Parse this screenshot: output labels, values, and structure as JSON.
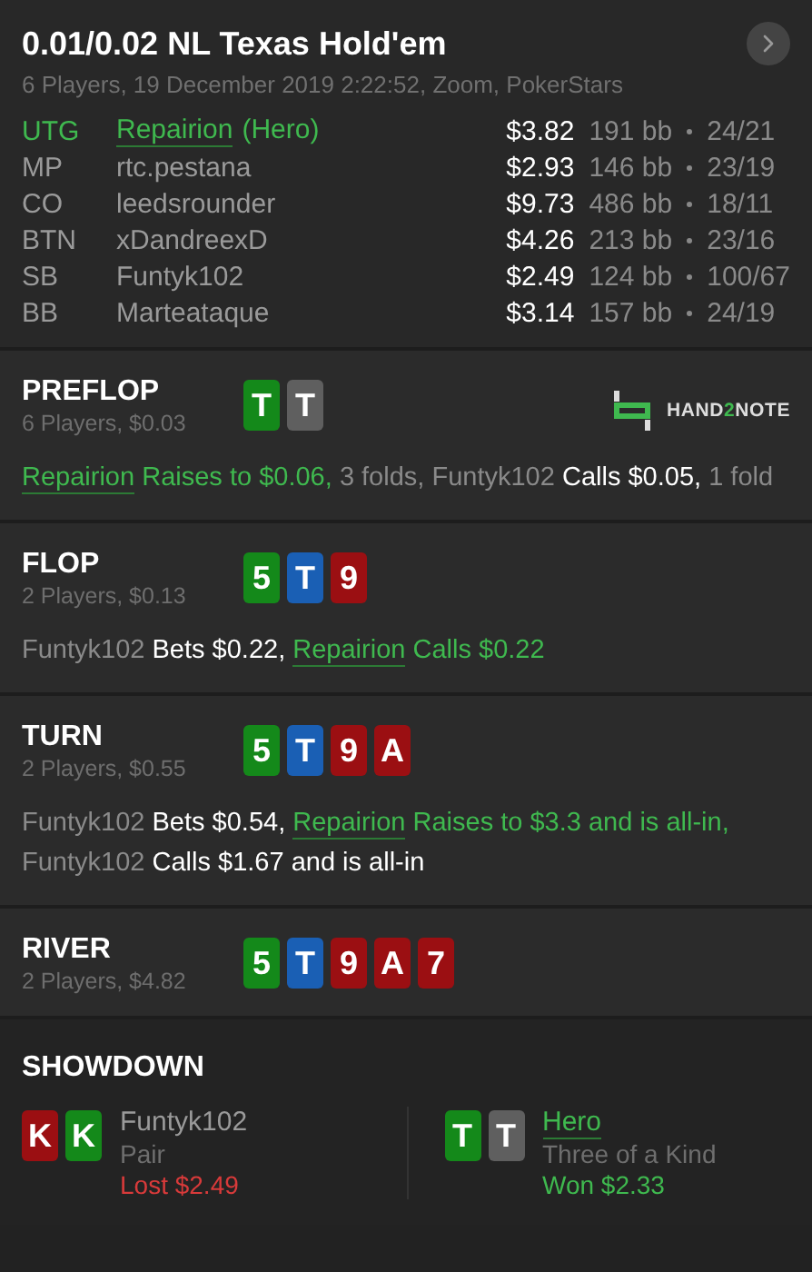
{
  "header": {
    "title": "0.01/0.02 NL Texas Hold'em",
    "subtitle": "6 Players, 19 December 2019 2:22:52, Zoom, PokerStars"
  },
  "players": [
    {
      "position": "UTG",
      "name": "Repairion",
      "hero": true,
      "hero_tag": "(Hero)",
      "stack": "$3.82",
      "bb": "191 bb",
      "stats": "24/21"
    },
    {
      "position": "MP",
      "name": "rtc.pestana",
      "hero": false,
      "stack": "$2.93",
      "bb": "146 bb",
      "stats": "23/19"
    },
    {
      "position": "CO",
      "name": "leedsrounder",
      "hero": false,
      "stack": "$9.73",
      "bb": "486 bb",
      "stats": "18/11"
    },
    {
      "position": "BTN",
      "name": "xDandreexD",
      "hero": false,
      "stack": "$4.26",
      "bb": "213 bb",
      "stats": "23/16"
    },
    {
      "position": "SB",
      "name": "Funtyk102",
      "hero": false,
      "stack": "$2.49",
      "bb": "124 bb",
      "stats": "100/67"
    },
    {
      "position": "BB",
      "name": "Marteataque",
      "hero": false,
      "stack": "$3.14",
      "bb": "157 bb",
      "stats": "24/19"
    }
  ],
  "logo": {
    "prefix": "HAND",
    "accent": "2",
    "suffix": "NOTE"
  },
  "streets": [
    {
      "name": "PREFLOP",
      "info": "6 Players, $0.03",
      "show_logo": true,
      "cards": [
        {
          "rank": "T",
          "color": "#14891a"
        },
        {
          "rank": "T",
          "color": "#5f5f5f"
        }
      ],
      "actions": [
        [
          {
            "kind": "hero",
            "text": "Repairion"
          },
          {
            "kind": "hero_action",
            "text": "Raises to $0.06,"
          },
          {
            "kind": "muted",
            "text": "3 folds, Funtyk102"
          },
          {
            "kind": "action",
            "text": "Calls $0.05,"
          },
          {
            "kind": "muted",
            "text": "1 fold"
          }
        ]
      ]
    },
    {
      "name": "FLOP",
      "info": "2 Players, $0.13",
      "show_logo": false,
      "cards": [
        {
          "rank": "5",
          "color": "#14891a"
        },
        {
          "rank": "T",
          "color": "#1a5fb4"
        },
        {
          "rank": "9",
          "color": "#9b0f12"
        }
      ],
      "actions": [
        [
          {
            "kind": "muted",
            "text": "Funtyk102"
          },
          {
            "kind": "action",
            "text": "Bets $0.22,"
          },
          {
            "kind": "hero",
            "text": "Repairion"
          },
          {
            "kind": "hero_action",
            "text": "Calls $0.22"
          }
        ]
      ]
    },
    {
      "name": "TURN",
      "info": "2 Players, $0.55",
      "show_logo": false,
      "cards": [
        {
          "rank": "5",
          "color": "#14891a"
        },
        {
          "rank": "T",
          "color": "#1a5fb4"
        },
        {
          "rank": "9",
          "color": "#9b0f12"
        },
        {
          "rank": "A",
          "color": "#9b0f12"
        }
      ],
      "actions": [
        [
          {
            "kind": "muted",
            "text": "Funtyk102"
          },
          {
            "kind": "action",
            "text": "Bets $0.54,"
          },
          {
            "kind": "hero",
            "text": "Repairion"
          },
          {
            "kind": "hero_action",
            "text": "Raises to $3.3 and is all-in,"
          }
        ],
        [
          {
            "kind": "muted",
            "text": "Funtyk102"
          },
          {
            "kind": "action",
            "text": "Calls $1.67 and is all-in"
          }
        ]
      ]
    },
    {
      "name": "RIVER",
      "info": "2 Players, $4.82",
      "show_logo": false,
      "cards": [
        {
          "rank": "5",
          "color": "#14891a"
        },
        {
          "rank": "T",
          "color": "#1a5fb4"
        },
        {
          "rank": "9",
          "color": "#9b0f12"
        },
        {
          "rank": "A",
          "color": "#9b0f12"
        },
        {
          "rank": "7",
          "color": "#9b0f12"
        }
      ]
    }
  ],
  "showdown": {
    "title": "SHOWDOWN",
    "hands": [
      {
        "name": "Funtyk102",
        "hero": false,
        "hand": "Pair",
        "result": "Lost $2.49",
        "won": false,
        "cards": [
          {
            "rank": "K",
            "color": "#9b0f12"
          },
          {
            "rank": "K",
            "color": "#14891a"
          }
        ]
      },
      {
        "name": "Hero",
        "hero": true,
        "hand": "Three of a Kind",
        "result": "Won $2.33",
        "won": true,
        "cards": [
          {
            "rank": "T",
            "color": "#14891a"
          },
          {
            "rank": "T",
            "color": "#5f5f5f"
          }
        ]
      }
    ]
  }
}
